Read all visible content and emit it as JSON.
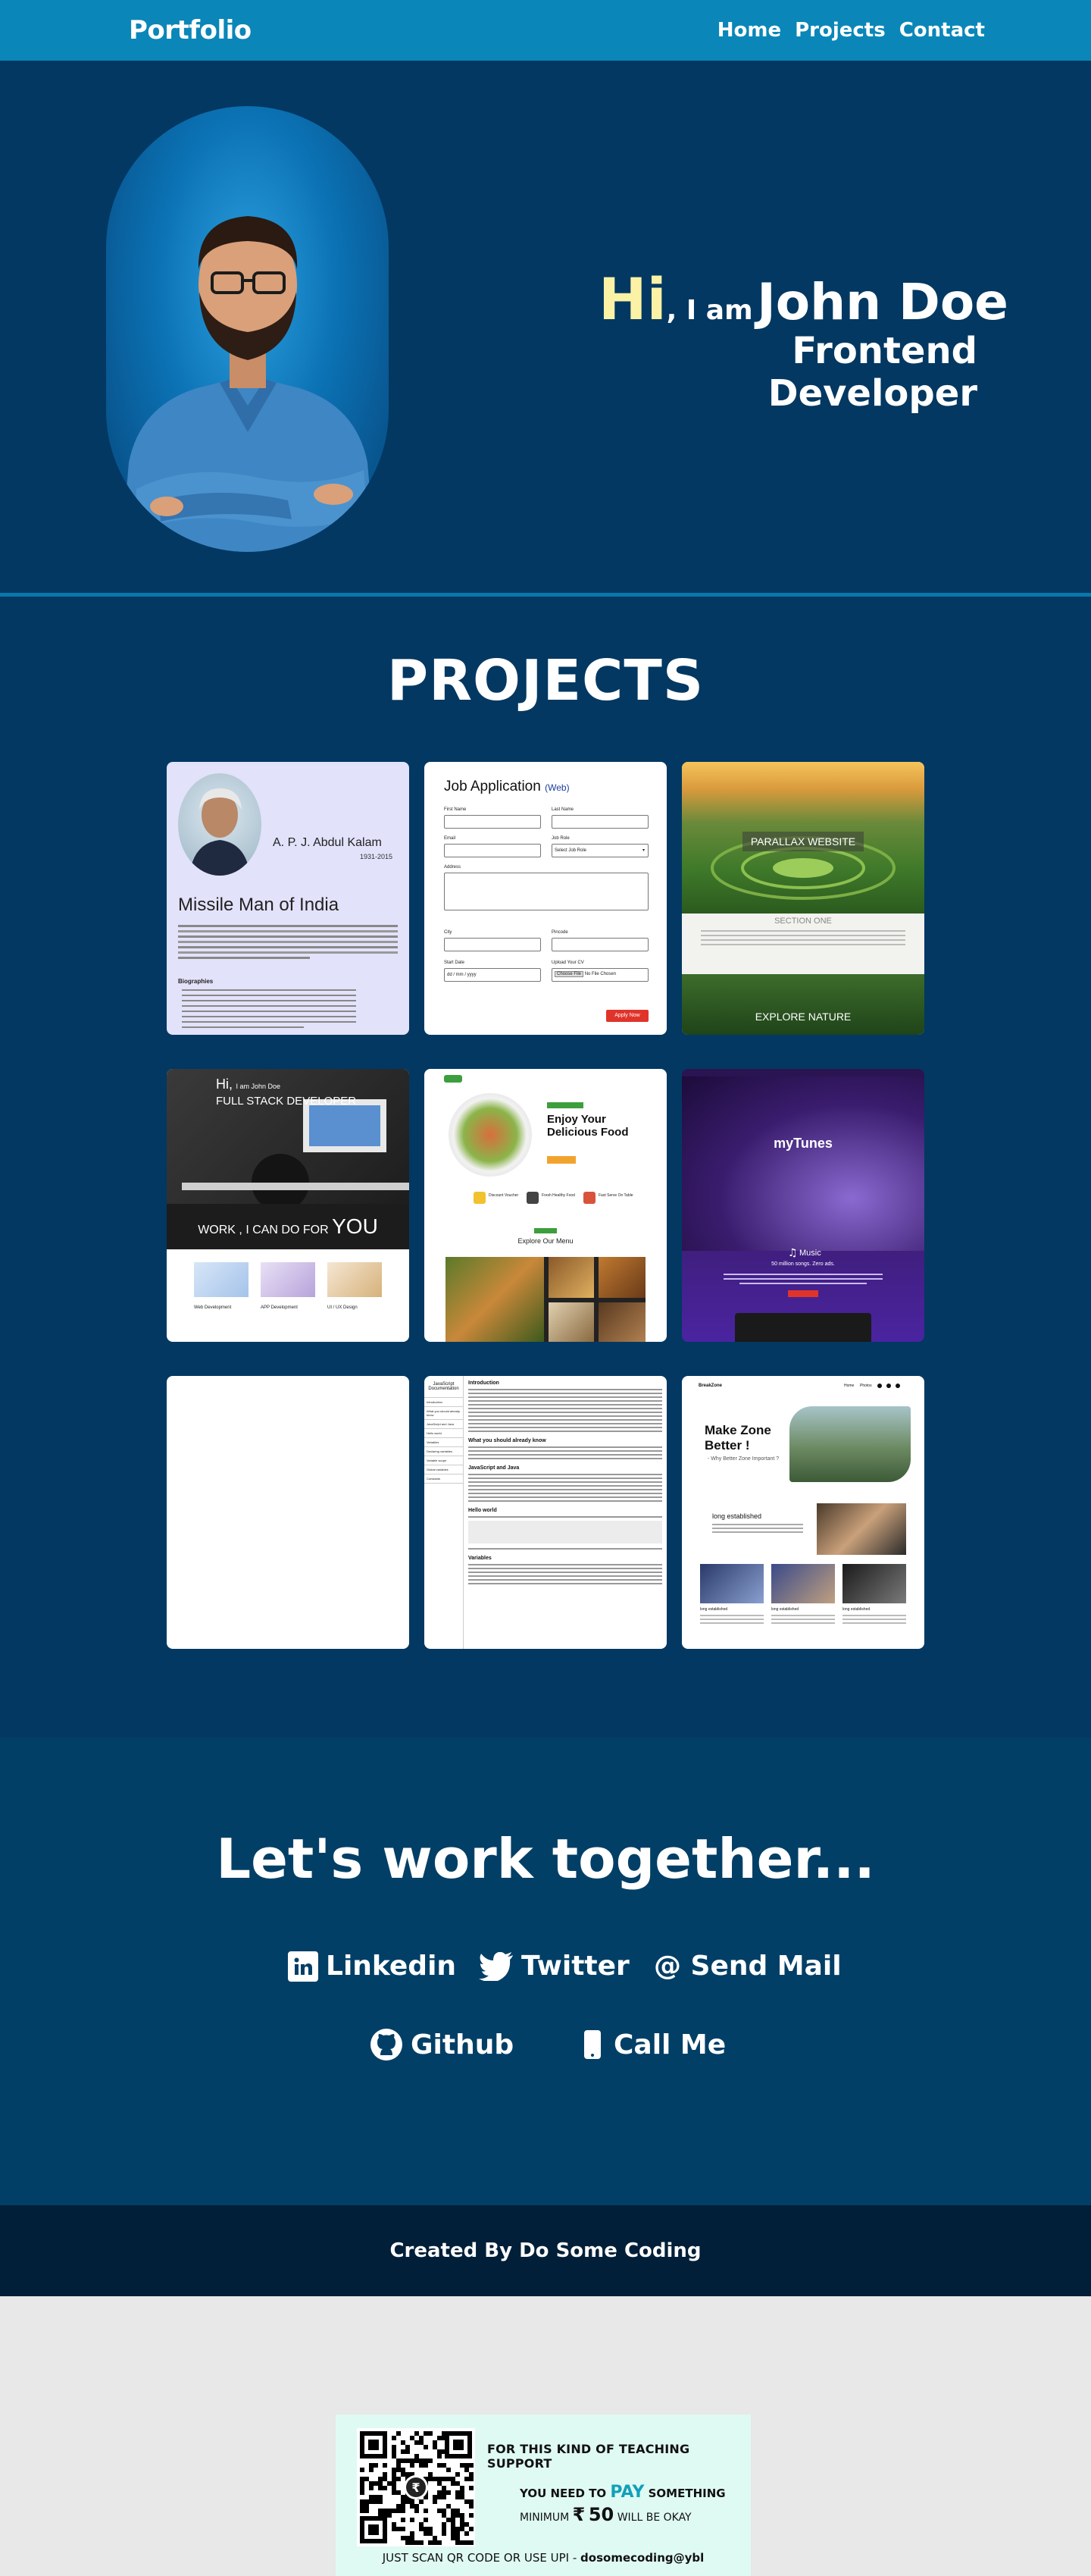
{
  "nav": {
    "brand": "Portfolio",
    "links": [
      "Home",
      "Projects",
      "Contact"
    ]
  },
  "hero": {
    "hi": "Hi",
    "iam": ", I am",
    "name": "John Doe",
    "role": "Frontend Developer"
  },
  "projects": {
    "title": "PROJECTS",
    "cards": [
      {
        "name": "A. P. J. Abdul Kalam",
        "years": "1931-2015",
        "headline": "Missile Man of India",
        "section": "Biographies"
      },
      {
        "title": "Job Application",
        "tag": "(Web)",
        "fields": [
          "First Name",
          "Last Name",
          "Email",
          "Job Role",
          "Address",
          "City",
          "Pincode",
          "Start Date",
          "Upload Your CV"
        ],
        "select_value": "Select Job Role",
        "date_value": "dd / mm / yyyy",
        "file_button": "Choose File",
        "file_status": "No File Chosen",
        "submit": "Apply Now"
      },
      {
        "hero_label": "PARALLAX WEBSITE",
        "section_label": "SECTION ONE",
        "bottom_label": "EXPLORE NATURE"
      },
      {
        "hi": "Hi,",
        "iam": "I am John Doe",
        "role": "FULL STACK DEVELOPER",
        "banner": "WORK , I CAN DO FOR",
        "banner_big": "YOU",
        "services": [
          "Web Development",
          "APP Development",
          "UI / UX Design"
        ]
      },
      {
        "headline": "Enjoy Your Delicious Food",
        "features": [
          "Discount Voucher",
          "Fresh Healthy Food",
          "Fast Serve On Table"
        ],
        "menu_title": "Explore Our Menu"
      },
      {
        "title": "myTunes",
        "subtitle": "Music",
        "tagline": "50 million songs. Zero ads."
      },
      {},
      {
        "sidebar_title": "JavaScript Documentation",
        "sidebar_items": [
          "Introduction",
          "What you should already know",
          "JavaScript and Java",
          "Hello world",
          "Variables",
          "Declaring variables",
          "Variable scope",
          "Global variables",
          "Constants"
        ],
        "sections": [
          "Introduction",
          "What you should already know",
          "JavaScript and Java",
          "Hello world",
          "Variables"
        ]
      },
      {
        "brand": "BreakZone",
        "nav": [
          "Home",
          "Photos"
        ],
        "headline": "Make Zone Better !",
        "sub": "- Why Better Zone Important ?",
        "block_title": "long established",
        "items": [
          "long established",
          "long established",
          "long established"
        ]
      }
    ]
  },
  "work": {
    "title": "Let's work together...",
    "links": [
      {
        "label": "Linkedin",
        "icon": "linkedin-icon"
      },
      {
        "label": "Twitter",
        "icon": "twitter-icon"
      },
      {
        "label": "@ Send Mail",
        "icon": "at-icon"
      },
      {
        "label": "Github",
        "icon": "github-icon"
      },
      {
        "label": "Call Me",
        "icon": "phone-icon"
      }
    ]
  },
  "footer": {
    "text": "Created By Do Some Coding"
  },
  "support": {
    "line1": "FOR THIS KIND OF TEACHING SUPPORT",
    "you_need_to": "YOU NEED TO",
    "pay": "PAY",
    "something": "SOMETHING",
    "minimum": "MINIMUM",
    "currency": "₹",
    "amount": "50",
    "will_be_okay": "WILL BE OKAY",
    "scan_text": "JUST SCAN QR CODE OR USE UPI -",
    "upi": "dosomecoding@ybl"
  },
  "colors": {
    "navbar": "#0a87b8",
    "hero_bg": "#023862",
    "hi_color": "#fbf2a6",
    "work_bg": "#023f66",
    "footer_bg": "#011f38",
    "support_bg": "#dffaf3",
    "pay_color": "#11a0b8"
  }
}
